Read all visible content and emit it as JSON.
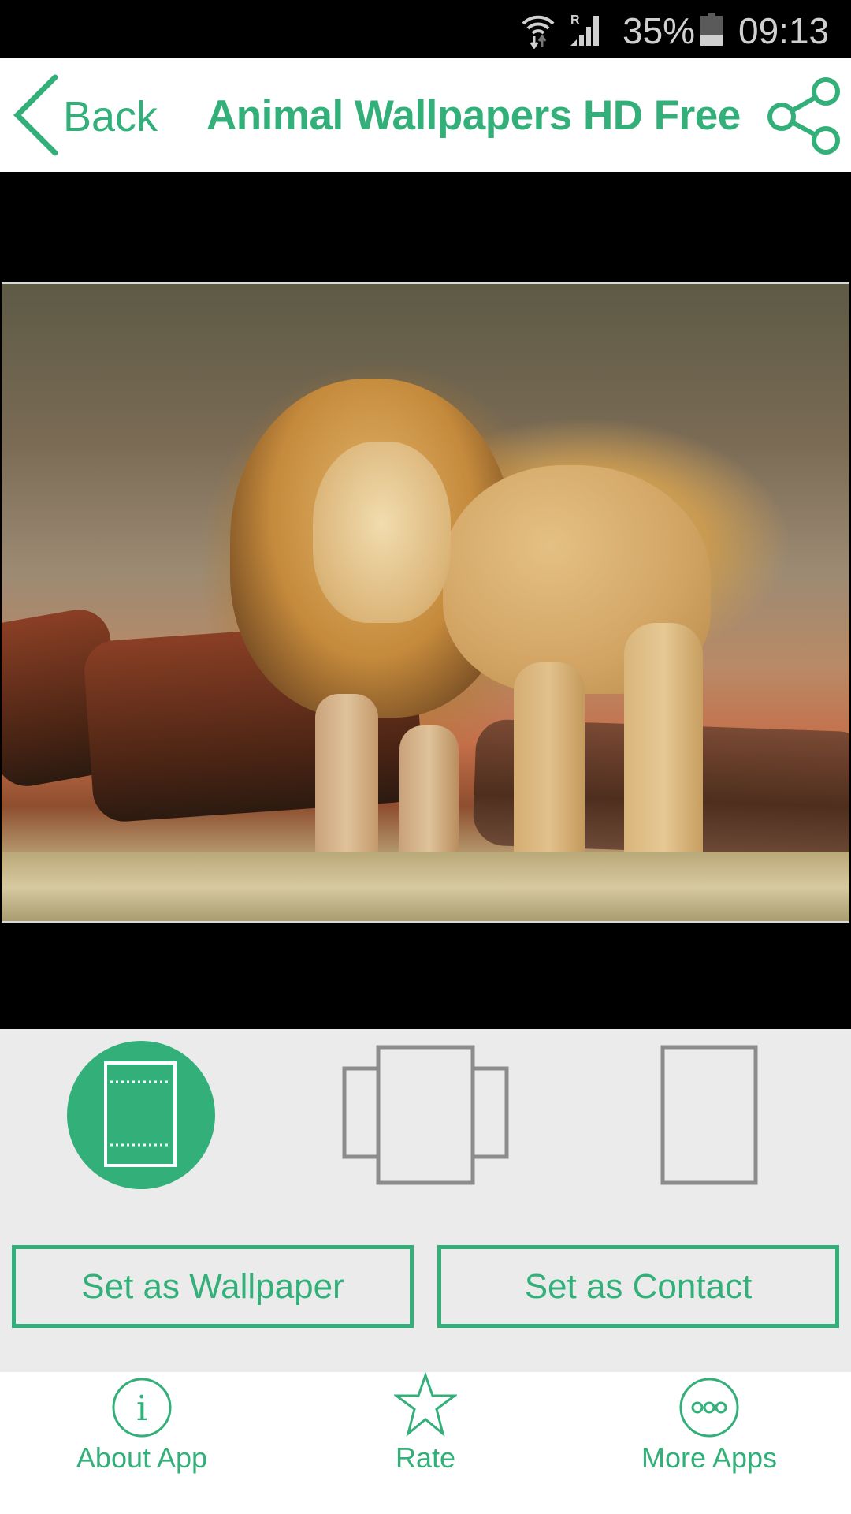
{
  "status_bar": {
    "battery_percent": "35%",
    "battery_level": 0.35,
    "time": "09:13",
    "icons": [
      "wifi-icon",
      "signal-roaming-icon",
      "battery-icon"
    ]
  },
  "header": {
    "back_label": "Back",
    "title": "Animal Wallpapers HD Free",
    "share_icon": "share-icon"
  },
  "preview": {
    "subject": "lion standing in front of logs"
  },
  "mode_options": [
    {
      "name": "fit-screen-mode",
      "selected": true
    },
    {
      "name": "scrolling-mode",
      "selected": false
    },
    {
      "name": "single-screen-mode",
      "selected": false
    }
  ],
  "actions": {
    "set_wallpaper": "Set as Wallpaper",
    "set_contact": "Set as Contact"
  },
  "bottom_nav": [
    {
      "label": "About App",
      "icon": "info-icon"
    },
    {
      "label": "Rate",
      "icon": "star-icon"
    },
    {
      "label": "More Apps",
      "icon": "more-icon"
    }
  ],
  "colors": {
    "accent": "#33b07a",
    "panel_bg": "#ebebeb",
    "icon_gray": "#8c8c8c"
  }
}
